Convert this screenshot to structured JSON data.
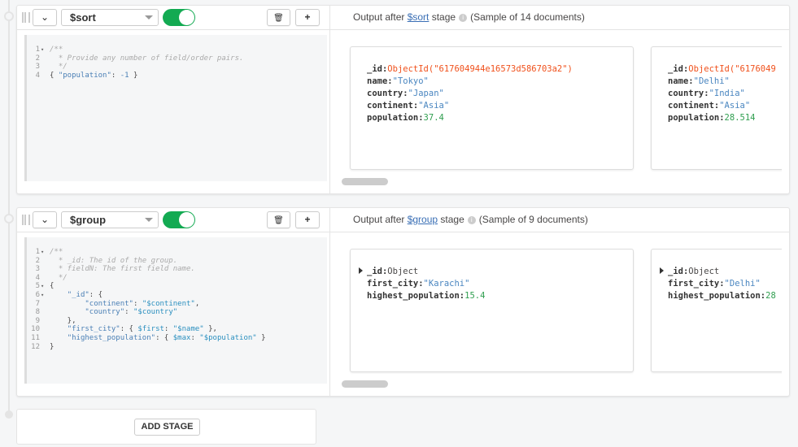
{
  "stages": [
    {
      "operator": "$sort",
      "enabled": true,
      "code": [
        {
          "n": "1",
          "fold": true,
          "html": "<span class='cm'>/**</span>"
        },
        {
          "n": "2",
          "html": "<span class='cm'>  * Provide any number of field/order pairs.</span>"
        },
        {
          "n": "3",
          "html": "<span class='cm'>  */</span>"
        },
        {
          "n": "4",
          "html": "{ <span class='ky'>\"population\"</span>: <span class='nu'>-1</span> }"
        }
      ],
      "output": {
        "prefix": "Output after ",
        "link": "$sort",
        "suffix": " stage",
        "sample": "(Sample of 14 documents)"
      },
      "docs": [
        [
          {
            "k": "_id",
            "v": "ObjectId(\"617604944e16573d586703a2\")",
            "t": "oid"
          },
          {
            "k": "name",
            "v": "\"Tokyo\"",
            "t": "sv"
          },
          {
            "k": "country",
            "v": "\"Japan\"",
            "t": "sv"
          },
          {
            "k": "continent",
            "v": "\"Asia\"",
            "t": "sv"
          },
          {
            "k": "population",
            "v": "37.4",
            "t": "nv"
          }
        ],
        [
          {
            "k": "_id",
            "v": "ObjectId(\"6176049",
            "t": "oid"
          },
          {
            "k": "name",
            "v": "\"Delhi\"",
            "t": "sv"
          },
          {
            "k": "country",
            "v": "\"India\"",
            "t": "sv"
          },
          {
            "k": "continent",
            "v": "\"Asia\"",
            "t": "sv"
          },
          {
            "k": "population",
            "v": "28.514",
            "t": "nv"
          }
        ]
      ]
    },
    {
      "operator": "$group",
      "enabled": true,
      "code": [
        {
          "n": "1",
          "fold": true,
          "html": "<span class='cm'>/**</span>"
        },
        {
          "n": "2",
          "html": "<span class='cm'>  * _id: The id of the group.</span>"
        },
        {
          "n": "3",
          "html": "<span class='cm'>  * fieldN: The first field name.</span>"
        },
        {
          "n": "4",
          "html": "<span class='cm'>  */</span>"
        },
        {
          "n": "5",
          "fold": true,
          "html": "{"
        },
        {
          "n": "6",
          "fold": true,
          "html": "    <span class='ky'>\"_id\"</span>: {"
        },
        {
          "n": "7",
          "html": "        <span class='ky'>\"continent\"</span>: <span class='st'>\"$continent\"</span>,"
        },
        {
          "n": "8",
          "html": "        <span class='ky'>\"country\"</span>: <span class='st'>\"$country\"</span>"
        },
        {
          "n": "9",
          "html": "    },"
        },
        {
          "n": "10",
          "html": "    <span class='ky'>\"first_city\"</span>: { <span class='st'>$first</span>: <span class='st'>\"$name\"</span> },"
        },
        {
          "n": "11",
          "html": "    <span class='ky'>\"highest_population\"</span>: { <span class='st'>$max</span>: <span class='st'>\"$population\"</span> }"
        },
        {
          "n": "12",
          "html": "}"
        }
      ],
      "output": {
        "prefix": "Output after ",
        "link": "$group",
        "suffix": " stage",
        "sample": "(Sample of 9 documents)"
      },
      "docs": [
        [
          {
            "k": "_id",
            "v": "Object",
            "t": "fk2",
            "expand": true
          },
          {
            "k": "first_city",
            "v": "\"Karachi\"",
            "t": "sv"
          },
          {
            "k": "highest_population",
            "v": "15.4",
            "t": "nv"
          }
        ],
        [
          {
            "k": "_id",
            "v": "Object",
            "t": "fk2",
            "expand": true
          },
          {
            "k": "first_city",
            "v": "\"Delhi\"",
            "t": "sv"
          },
          {
            "k": "highest_population",
            "v": "28",
            "t": "nv"
          }
        ]
      ]
    }
  ],
  "toolbar": {
    "collapse": "⌄",
    "delete": "🗑",
    "add": "+"
  },
  "add_stage": "ADD STAGE"
}
